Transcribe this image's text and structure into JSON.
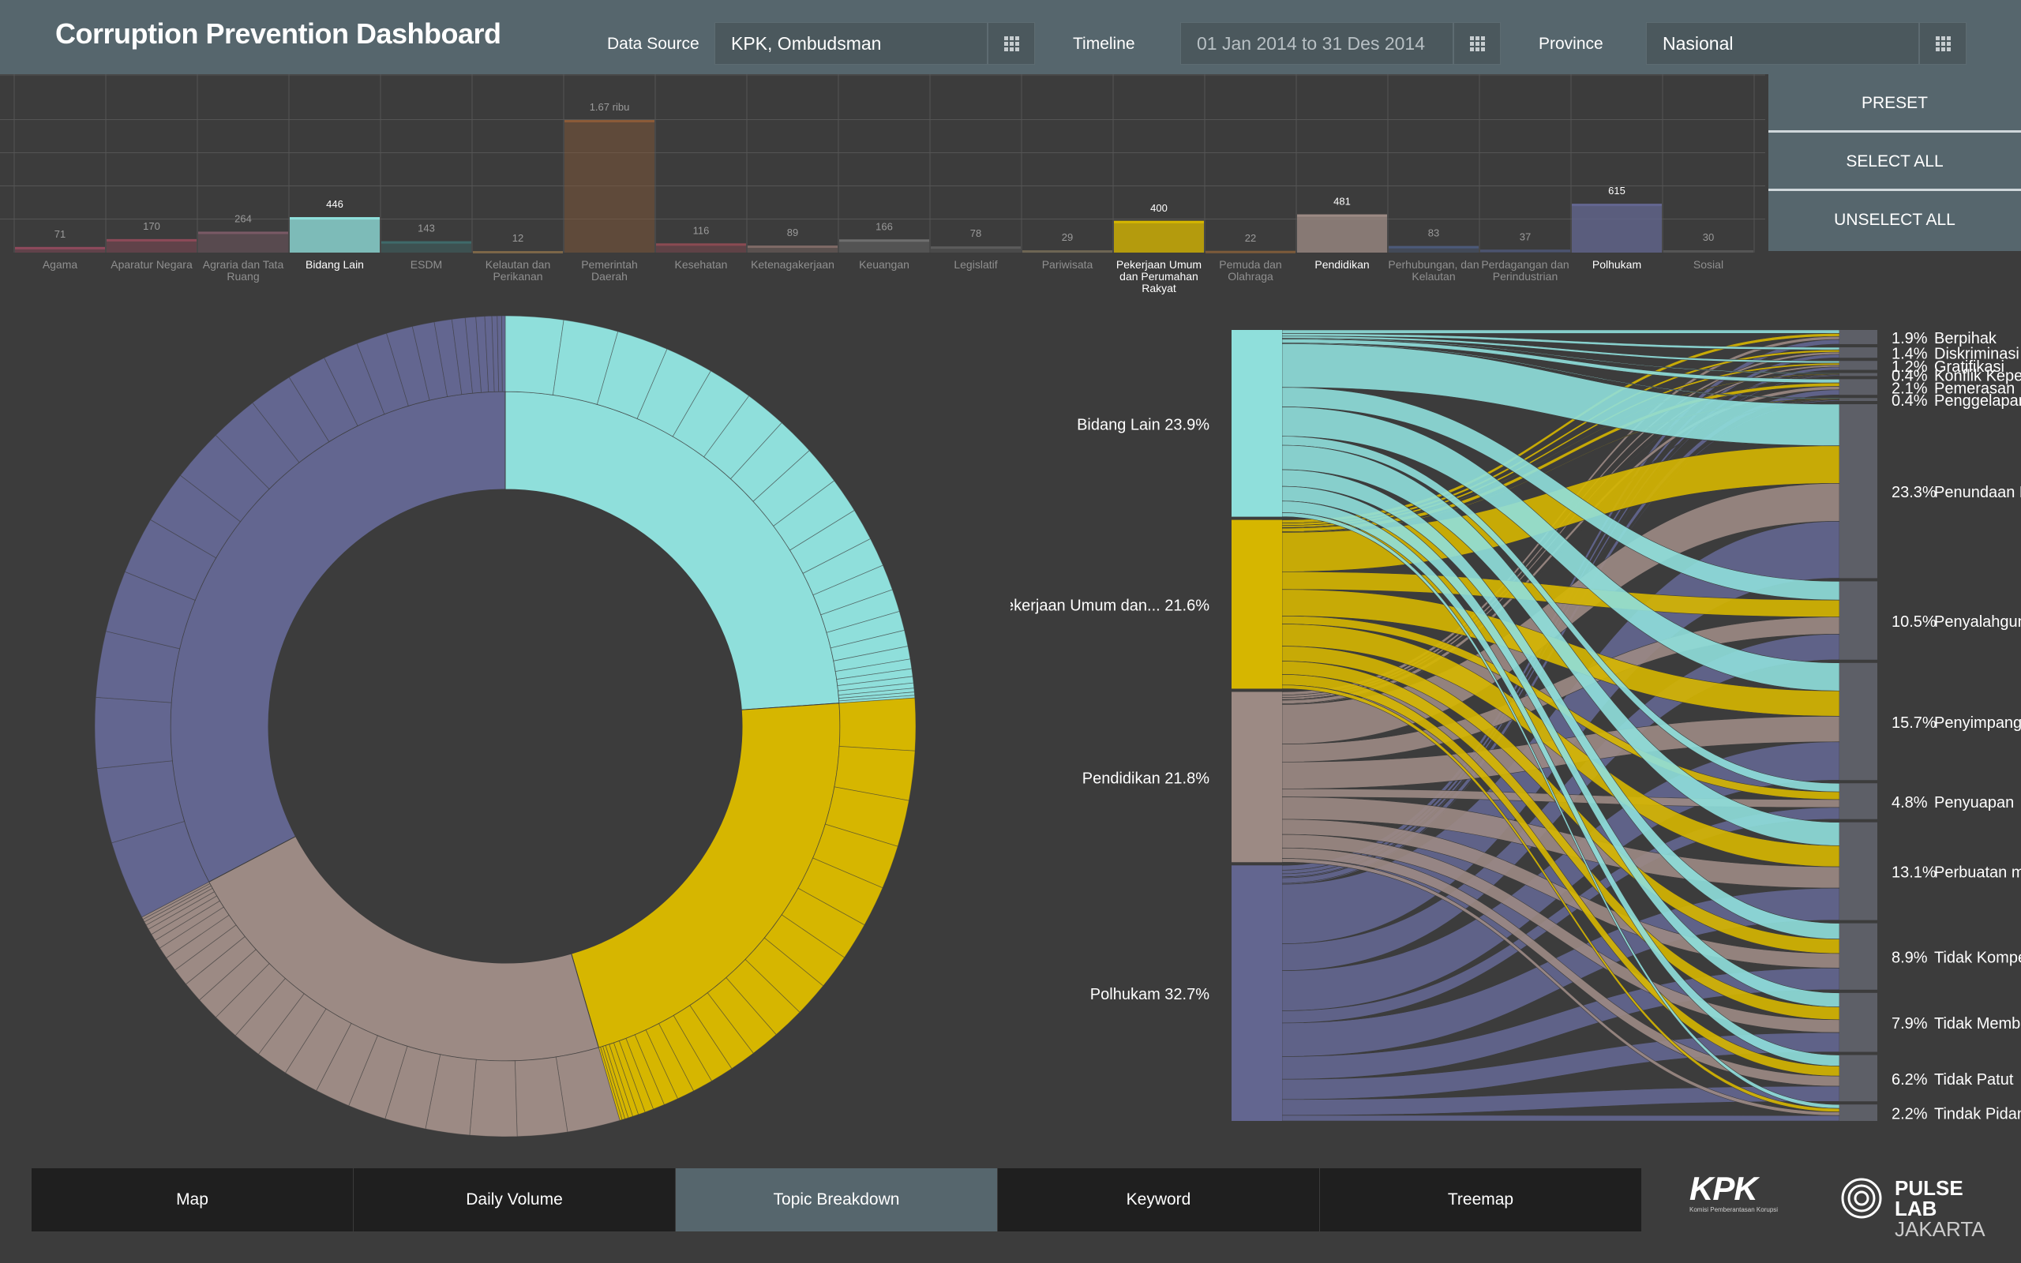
{
  "header": {
    "title": "Corruption Prevention Dashboard",
    "data_source_label": "Data Source",
    "data_source_value": "KPK, Ombudsman",
    "timeline_label": "Timeline",
    "timeline_value": "01 Jan 2014 to 31 Des 2014",
    "province_label": "Province",
    "province_value": "Nasional"
  },
  "buttons": {
    "preset": "PRESET",
    "select_all": "SELECT ALL",
    "unselect_all": "UNSELECT ALL"
  },
  "tabs": [
    "Map",
    "Daily Volume",
    "Topic Breakdown",
    "Keyword",
    "Treemap"
  ],
  "active_tab": "Topic Breakdown",
  "logos": {
    "kpk": "KPK",
    "kpk_sub": "Komisi Pemberantasan Korupsi",
    "pulse1": "PULSE",
    "pulse2": "LAB",
    "pulse3": "JAKARTA"
  },
  "colors": {
    "cyan": "#8fdfdb",
    "yellow": "#d6b600",
    "taupe": "#9c8a84",
    "purple": "#636690"
  },
  "chart_data": [
    {
      "type": "bar",
      "categories": [
        "Agama",
        "Aparatur Negara",
        "Agraria dan Tata Ruang",
        "Bidang Lain",
        "ESDM",
        "Kelautan dan Perikanan",
        "Pemerintah Daerah",
        "Kesehatan",
        "Ketenagakerjaan",
        "Keuangan",
        "Legislatif",
        "Pariwisata",
        "Pekerjaan Umum dan Perumahan Rakyat",
        "Pemuda dan Olahraga",
        "Pendidikan",
        "Perhubungan, dan Kelautan",
        "Perdagangan dan Perindustrian",
        "Polhukam",
        "Sosial"
      ],
      "values": [
        71,
        170,
        264,
        446,
        143,
        12,
        1670,
        116,
        89,
        166,
        78,
        29,
        400,
        22,
        481,
        83,
        37,
        615,
        30
      ],
      "value_labels": [
        "71",
        "170",
        "264",
        "446",
        "143",
        "12",
        "1.67 ribu",
        "116",
        "89",
        "166",
        "78",
        "29",
        "400",
        "22",
        "481",
        "83",
        "37",
        "615",
        "30"
      ],
      "selected": [
        "Bidang Lain",
        "Pekerjaan Umum dan Perumahan Rakyat",
        "Pendidikan",
        "Polhukam"
      ],
      "bar_colors": [
        "#8e4a5c",
        "#8c4a58",
        "#7a5a66",
        "#8fdfdb",
        "#3f6a6a",
        "#7c6648",
        "#8a5a38",
        "#8a4a52",
        "#7e6a66",
        "#6e6e6e",
        "#5c5c5c",
        "#6e6654",
        "#d6b600",
        "#7c5a3a",
        "#9c8a84",
        "#4c5a7a",
        "#4c5470",
        "#636690",
        "#555555"
      ],
      "ylim": [
        0,
        1670
      ]
    },
    {
      "type": "sunburst",
      "segments": [
        {
          "name": "Bidang Lain",
          "value": 23.9,
          "color": "#8fdfdb"
        },
        {
          "name": "Pekerjaan Umum dan Perumahan Rakyat",
          "value": 21.6,
          "color": "#d6b600"
        },
        {
          "name": "Pendidikan",
          "value": 21.8,
          "color": "#9c8a84"
        },
        {
          "name": "Polhukam",
          "value": 32.7,
          "color": "#636690"
        }
      ]
    },
    {
      "type": "sankey",
      "sources": [
        {
          "name": "Bidang Lain",
          "label": "Bidang Lain",
          "pct": 23.9,
          "color": "#8fdfdb"
        },
        {
          "name": "Pekerjaan Umum dan Perumahan Rakyat",
          "label": "Pekerjaan Umum dan...",
          "pct": 21.6,
          "color": "#d6b600"
        },
        {
          "name": "Pendidikan",
          "label": "Pendidikan",
          "pct": 21.8,
          "color": "#9c8a84"
        },
        {
          "name": "Polhukam",
          "label": "Polhukam",
          "pct": 32.7,
          "color": "#636690"
        }
      ],
      "targets": [
        {
          "name": "Berpihak",
          "label": "Berpihak",
          "pct": 1.9
        },
        {
          "name": "Diskriminasi",
          "label": "Diskriminasi",
          "pct": 1.4
        },
        {
          "name": "Gratifikasi",
          "label": "Gratifikasi",
          "pct": 1.2
        },
        {
          "name": "Konflik Kepentingan",
          "label": "Konflik Kepentingan",
          "pct": 0.4
        },
        {
          "name": "Pemerasan",
          "label": "Pemerasan",
          "pct": 2.1
        },
        {
          "name": "Penggelapan dalam ...",
          "label": "Penggelapan dalam ...",
          "pct": 0.4
        },
        {
          "name": "Penundaan Berlarut",
          "label": "Penundaan Berlarut",
          "pct": 23.3
        },
        {
          "name": "Penyalahgunaan W...",
          "label": "Penyalahgunaan W...",
          "pct": 10.5
        },
        {
          "name": "Penyimpangan Prose...",
          "label": "Penyimpangan Prose...",
          "pct": 15.7
        },
        {
          "name": "Penyuapan",
          "label": "Penyuapan",
          "pct": 4.8
        },
        {
          "name": "Perbuatan melawan ...",
          "label": "Perbuatan melawan ...",
          "pct": 13.1
        },
        {
          "name": "Tidak Kompeten",
          "label": "Tidak Kompeten",
          "pct": 8.9
        },
        {
          "name": "Tidak Memberikan P...",
          "label": "Tidak Memberikan P...",
          "pct": 7.9
        },
        {
          "name": "Tidak Patut",
          "label": "Tidak Patut",
          "pct": 6.2
        },
        {
          "name": "Tindak Pidana lain y...",
          "label": "Tindak Pidana lain y...",
          "pct": 2.2
        }
      ]
    }
  ]
}
